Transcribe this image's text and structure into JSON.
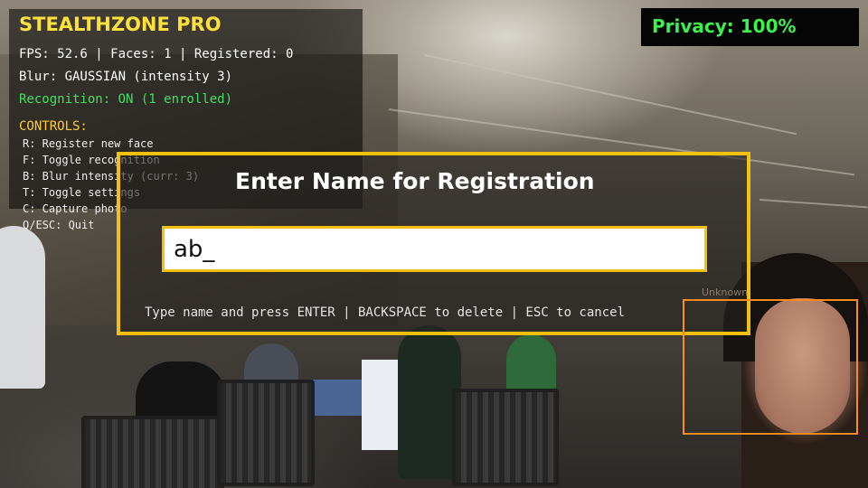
{
  "hud": {
    "title": "STEALTHZONE PRO",
    "stats": "FPS: 52.6 | Faces: 1 | Registered: 0",
    "blur": "Blur: GAUSSIAN (intensity 3)",
    "recognition": "Recognition: ON (1 enrolled)",
    "controls_header": "CONTROLS:",
    "controls": [
      "R: Register new face",
      "F: Toggle recognition",
      "B: Blur intensity (curr: 3)",
      "T: Toggle settings",
      "C: Capture photo",
      "Q/ESC: Quit"
    ]
  },
  "privacy": {
    "label": "Privacy: 100%"
  },
  "dialog": {
    "title": "Enter Name for Registration",
    "input_value": "ab_",
    "hint": "Type name and press ENTER | BACKSPACE to delete | ESC to cancel"
  },
  "face": {
    "label": "Unknown"
  },
  "colors": {
    "hud_title": "#ffe13a",
    "status_green": "#40e060",
    "privacy_green": "#3ef04a",
    "dialog_border": "#f4c010",
    "face_box": "#ff8c1a"
  }
}
